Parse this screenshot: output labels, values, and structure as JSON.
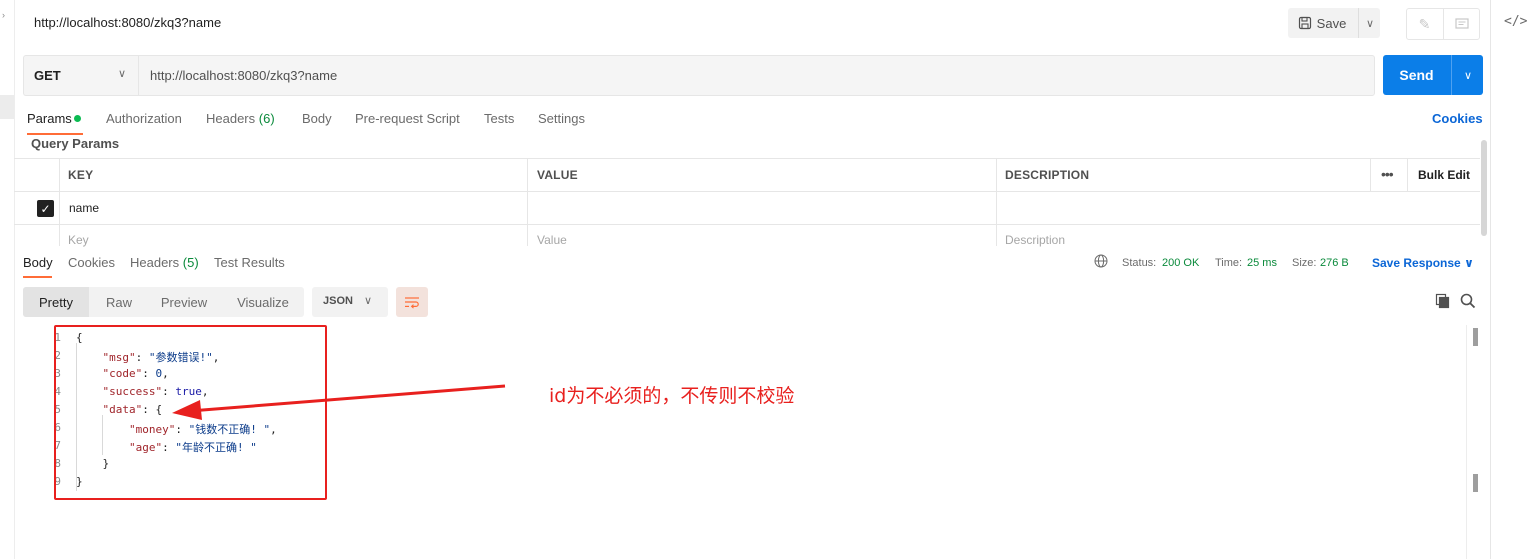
{
  "tab": {
    "title": "http://localhost:8080/zkq3?name"
  },
  "toolbar": {
    "save_label": "Save"
  },
  "request": {
    "method": "GET",
    "url": "http://localhost:8080/zkq3?name",
    "send_label": "Send",
    "tabs": [
      {
        "label": "Params"
      },
      {
        "label": "Authorization"
      },
      {
        "label": "Headers",
        "count": "(6)"
      },
      {
        "label": "Body"
      },
      {
        "label": "Pre-request Script"
      },
      {
        "label": "Tests"
      },
      {
        "label": "Settings"
      }
    ],
    "cookies_label": "Cookies"
  },
  "params": {
    "section_label": "Query Params",
    "headers": {
      "key": "KEY",
      "value": "VALUE",
      "description": "DESCRIPTION",
      "bulk_edit": "Bulk Edit"
    },
    "rows": [
      {
        "checked": true,
        "key": "name",
        "value": "",
        "description": ""
      }
    ],
    "placeholders": {
      "key": "Key",
      "value": "Value",
      "description": "Description"
    }
  },
  "response": {
    "tabs": [
      {
        "label": "Body"
      },
      {
        "label": "Cookies"
      },
      {
        "label": "Headers",
        "count": "(5)"
      },
      {
        "label": "Test Results"
      }
    ],
    "status_label": "Status:",
    "status_value": "200 OK",
    "time_label": "Time:",
    "time_value": "25 ms",
    "size_label": "Size:",
    "size_value": "276 B",
    "save_response_label": "Save Response",
    "formats": [
      "Pretty",
      "Raw",
      "Preview",
      "Visualize"
    ],
    "language": "JSON",
    "code_lines": [
      {
        "n": "1",
        "text": "{"
      },
      {
        "n": "2",
        "key": "\"msg\"",
        "value": "\"参数错误!\"",
        "tail": ","
      },
      {
        "n": "3",
        "key": "\"code\"",
        "value": "0",
        "tail": ","
      },
      {
        "n": "4",
        "key": "\"success\"",
        "value": "true",
        "tail": ","
      },
      {
        "n": "5",
        "key": "\"data\"",
        "value": "{",
        "tail": ""
      },
      {
        "n": "6",
        "key": "\"money\"",
        "value": "\"钱数不正确! \"",
        "tail": ","
      },
      {
        "n": "7",
        "key": "\"age\"",
        "value": "\"年龄不正确! \"",
        "tail": ""
      },
      {
        "n": "8",
        "text": "}"
      },
      {
        "n": "9",
        "text": "}"
      }
    ]
  },
  "annotation": {
    "text": "id为不必须的，不传则不校验",
    "color": "#e8201e"
  },
  "colors": {
    "accent": "#ff6c37",
    "send": "#0b7ee8",
    "ok": "#0a8a3b",
    "link": "#0b66d6"
  }
}
